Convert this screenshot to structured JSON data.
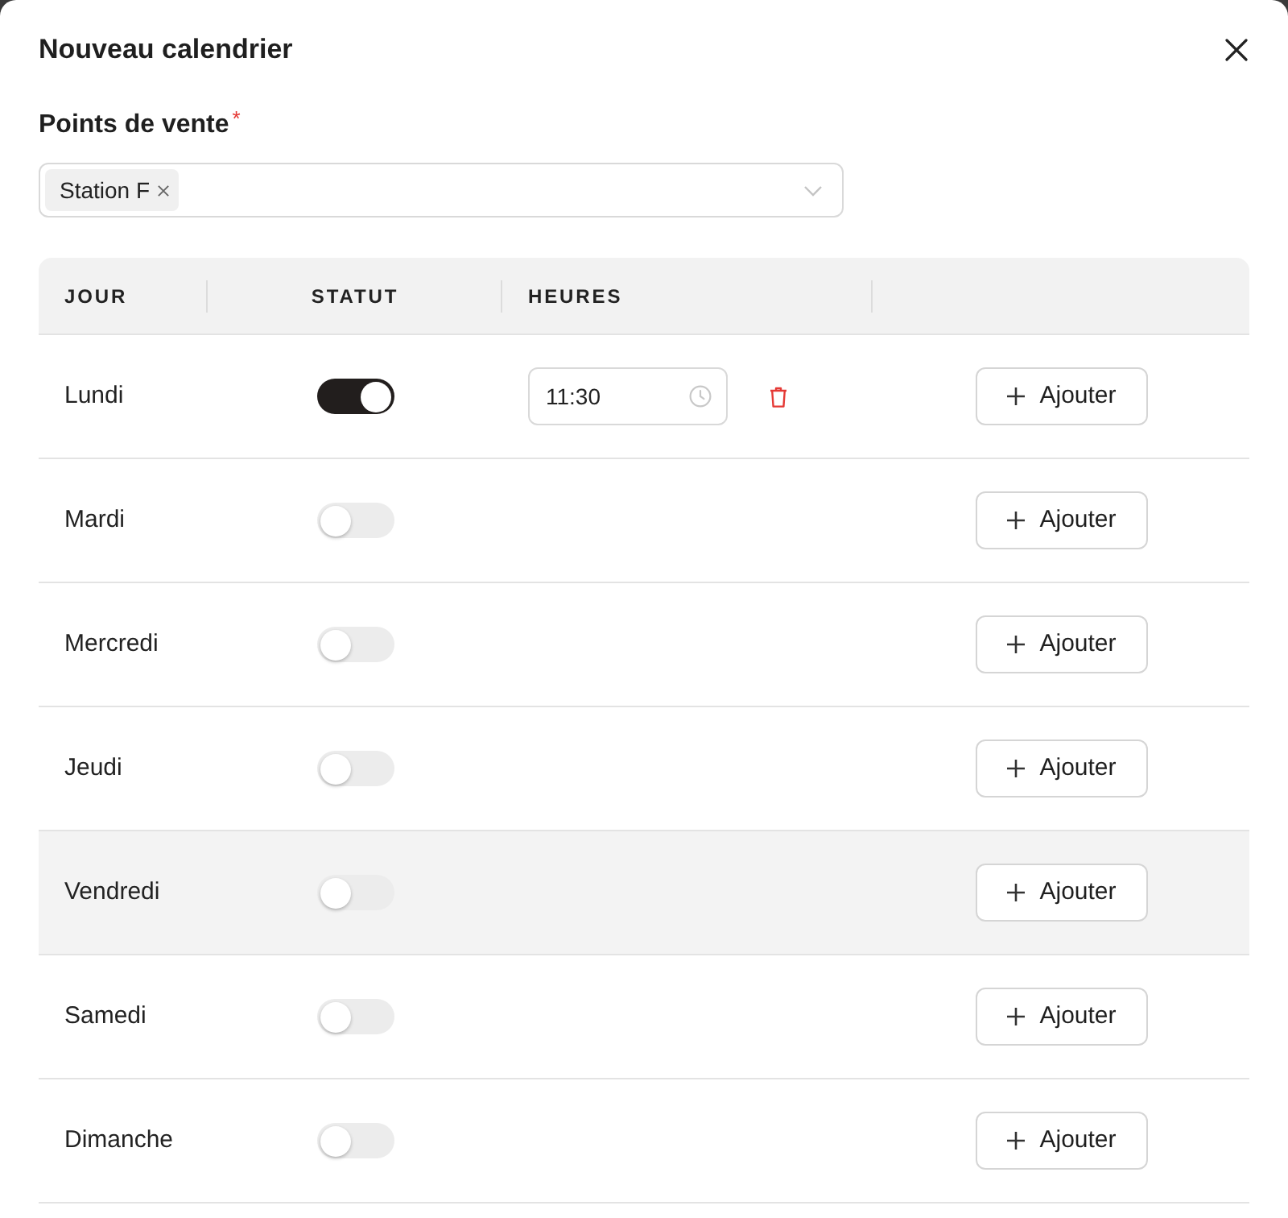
{
  "dialog": {
    "title": "Nouveau calendrier"
  },
  "points_de_vente": {
    "label": "Points de vente",
    "required_mark": "*",
    "tags": [
      {
        "label": "Station F"
      }
    ]
  },
  "table": {
    "columns": [
      "JOUR",
      "STATUT",
      "HEURES"
    ],
    "rows": [
      {
        "day": "Lundi",
        "on": true,
        "hovered": false,
        "times": [
          {
            "value": "11:30"
          }
        ],
        "add_label": "Ajouter"
      },
      {
        "day": "Mardi",
        "on": false,
        "hovered": false,
        "times": [],
        "add_label": "Ajouter"
      },
      {
        "day": "Mercredi",
        "on": false,
        "hovered": false,
        "times": [],
        "add_label": "Ajouter"
      },
      {
        "day": "Jeudi",
        "on": false,
        "hovered": false,
        "times": [],
        "add_label": "Ajouter"
      },
      {
        "day": "Vendredi",
        "on": false,
        "hovered": true,
        "times": [],
        "add_label": "Ajouter"
      },
      {
        "day": "Samedi",
        "on": false,
        "hovered": false,
        "times": [],
        "add_label": "Ajouter"
      },
      {
        "day": "Dimanche",
        "on": false,
        "hovered": false,
        "times": [],
        "add_label": "Ajouter"
      }
    ]
  }
}
